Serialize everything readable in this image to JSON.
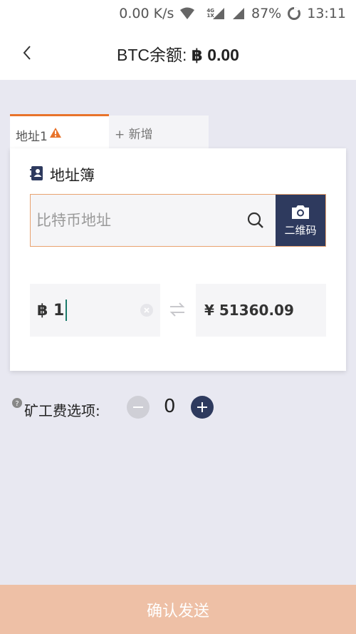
{
  "status_bar": {
    "speed": "0.00 K/s",
    "net_top": "4G",
    "net_bottom": "1X",
    "battery": "87%",
    "time": "13:11"
  },
  "header": {
    "title_prefix": "BTC余额: ",
    "balance": "฿ 0.00",
    "back_icon": "chevron-left-icon"
  },
  "tabs": [
    {
      "label": "地址1",
      "active": true,
      "badge_icon": "warning-icon"
    },
    {
      "label": "+ 新增",
      "active": false
    }
  ],
  "card": {
    "address_book_label": "地址簿",
    "address_placeholder": "比特币地址",
    "qr_label": "二维码",
    "btc_symbol": "฿",
    "btc_amount": "1",
    "fiat_value": "¥ 51360.09"
  },
  "fee": {
    "label": "矿工费选项:",
    "value": "0"
  },
  "confirm_label": "确认发送",
  "colors": {
    "accent_orange": "#e8732b",
    "navy": "#2e3a5e",
    "confirm_bg": "#eec0a6",
    "page_bg": "#e8e8f1"
  }
}
